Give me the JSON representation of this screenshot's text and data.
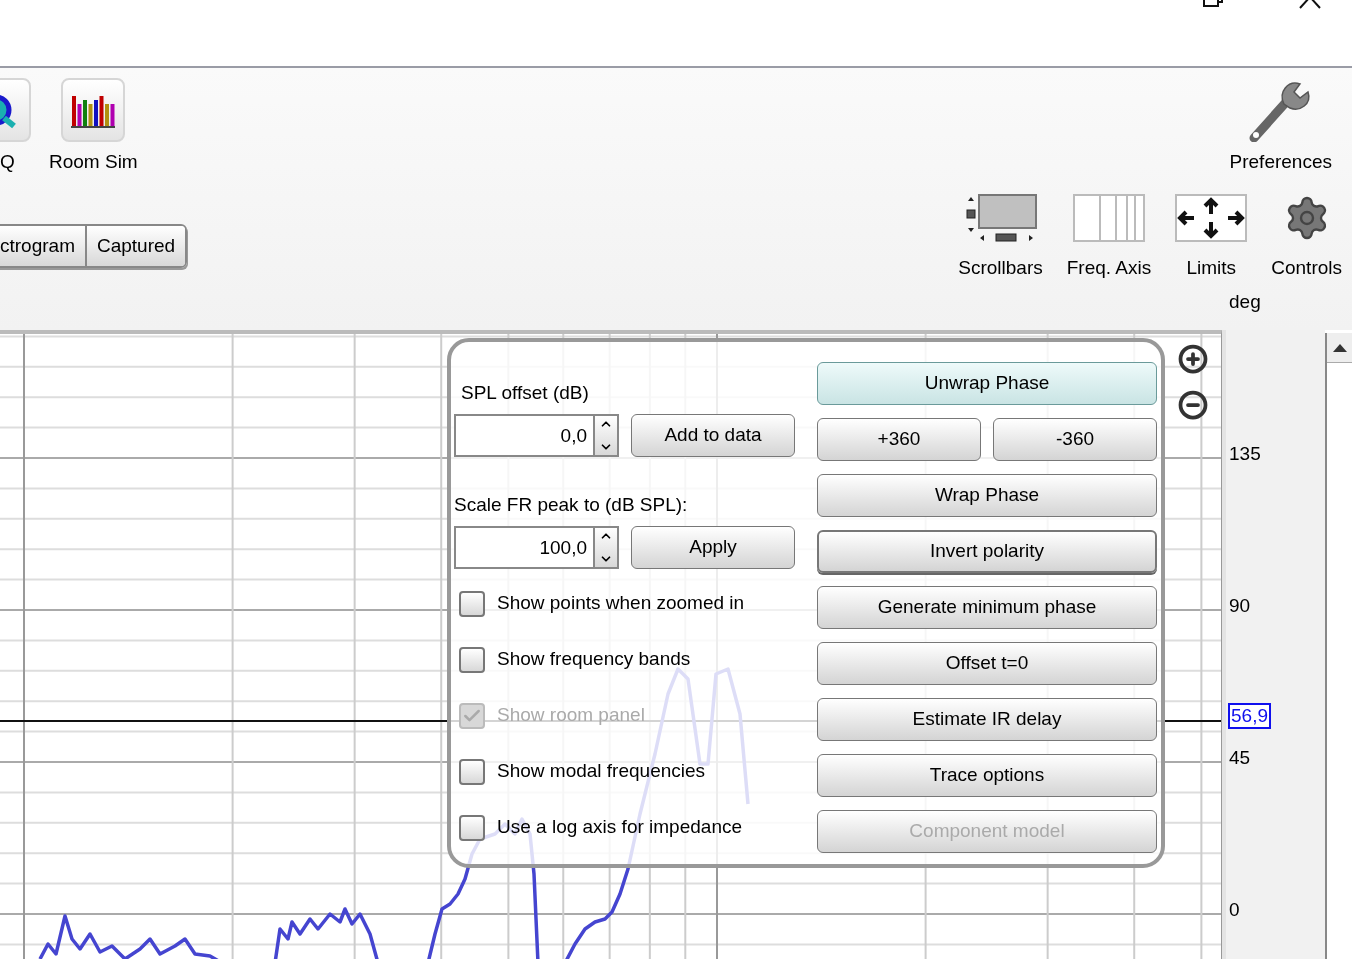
{
  "toolbar": {
    "top_items": [
      {
        "kind": "eq",
        "label": "Q"
      },
      {
        "kind": "room_sim",
        "label": "Room Sim"
      }
    ],
    "preferences": {
      "label": "Preferences"
    },
    "view_tabs": [
      {
        "label": "ctrogram",
        "selected": false
      },
      {
        "label": "Captured",
        "selected": false
      }
    ],
    "view_items": [
      {
        "kind": "scrollbars",
        "label": "Scrollbars"
      },
      {
        "kind": "freq_axis",
        "label": "Freq. Axis"
      },
      {
        "kind": "limits",
        "label": "Limits"
      },
      {
        "kind": "controls",
        "label": "Controls"
      }
    ]
  },
  "plot": {
    "y_axis": {
      "unit": "deg",
      "ticks": [
        "135",
        "90",
        "45",
        "0"
      ]
    },
    "cursor_readout": "56,9"
  },
  "controls_panel": {
    "spl_offset": {
      "label": "SPL offset (dB)",
      "value": "0,0"
    },
    "add_button": "Add to data",
    "scale_peak": {
      "label": "Scale FR peak to (dB SPL):",
      "value": "100,0"
    },
    "apply_button": "Apply",
    "checkboxes": [
      {
        "label": "Show points when zoomed in",
        "checked": false,
        "disabled": false
      },
      {
        "label": "Show frequency bands",
        "checked": false,
        "disabled": false
      },
      {
        "label": "Show room panel",
        "checked": true,
        "disabled": true
      },
      {
        "label": "Show modal frequencies",
        "checked": false,
        "disabled": false
      },
      {
        "label": "Use a log axis for impedance",
        "checked": false,
        "disabled": false
      }
    ],
    "button_rows": [
      [
        {
          "label": "Unwrap Phase",
          "highlighted": true,
          "focused": false,
          "disabled": false
        }
      ],
      [
        {
          "label": "+360",
          "highlighted": false,
          "focused": false,
          "disabled": false
        },
        {
          "label": "-360",
          "highlighted": false,
          "focused": false,
          "disabled": false
        }
      ],
      [
        {
          "label": "Wrap Phase",
          "highlighted": false,
          "focused": false,
          "disabled": false
        }
      ],
      [
        {
          "label": "Invert polarity",
          "highlighted": false,
          "focused": true,
          "disabled": false
        }
      ],
      [
        {
          "label": "Generate minimum phase",
          "highlighted": false,
          "focused": false,
          "disabled": false
        }
      ],
      [
        {
          "label": "Offset t=0",
          "highlighted": false,
          "focused": false,
          "disabled": false
        }
      ],
      [
        {
          "label": "Estimate IR delay",
          "highlighted": false,
          "focused": false,
          "disabled": false
        }
      ],
      [
        {
          "label": "Trace options",
          "highlighted": false,
          "focused": false,
          "disabled": false
        }
      ],
      [
        {
          "label": "Component model",
          "highlighted": false,
          "focused": false,
          "disabled": true
        }
      ]
    ]
  }
}
